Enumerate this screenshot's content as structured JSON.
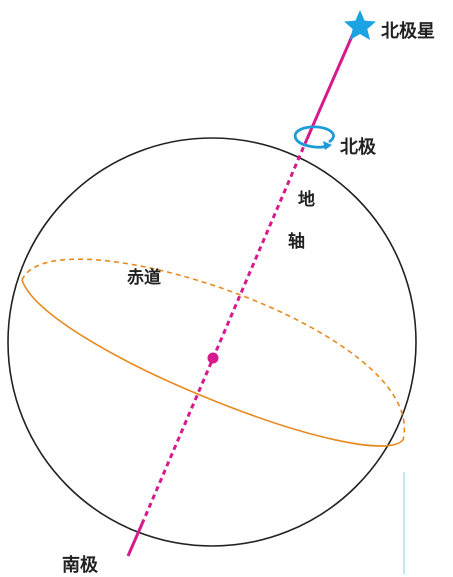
{
  "labels": {
    "polaris": "北极星",
    "north_pole": "北极",
    "axis_char_1": "地",
    "axis_char_2": "轴",
    "equator": "赤道",
    "south_pole": "南极"
  },
  "colors": {
    "axis": "#d6198c",
    "equator": "#e8891e",
    "rotation_arrow": "#1d9bd7",
    "star": "#1aa3e0",
    "sphere_outline": "#222222",
    "guide_line": "#a8dff2"
  },
  "icons": {
    "polaris": "star-icon",
    "rotation": "rotation-arrow-icon"
  }
}
